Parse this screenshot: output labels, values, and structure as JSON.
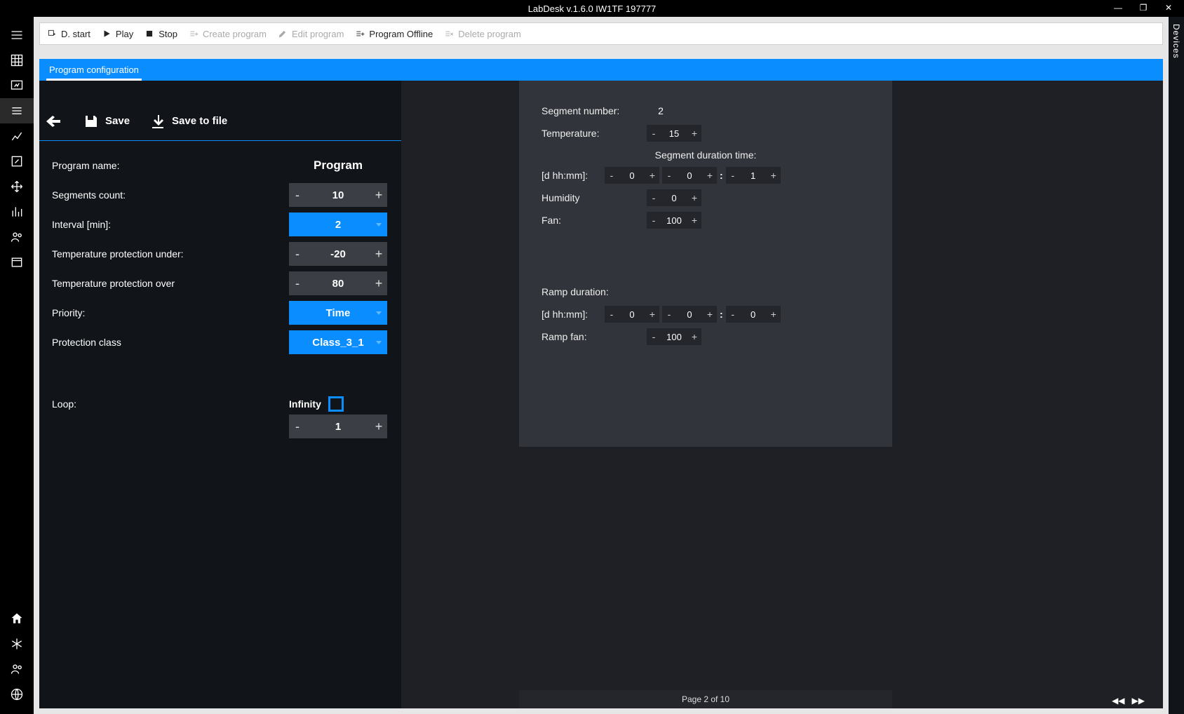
{
  "title": "LabDesk v.1.6.0 IW1TF 197777",
  "window_controls": {
    "min": "—",
    "max": "❐",
    "close": "✕"
  },
  "left_rail": {
    "items": [
      {
        "name": "menu-icon"
      },
      {
        "name": "grid-icon"
      },
      {
        "name": "monitor-icon"
      },
      {
        "name": "lines-icon",
        "active": true
      },
      {
        "name": "chart-icon"
      },
      {
        "name": "edit-square-icon"
      },
      {
        "name": "move-icon"
      },
      {
        "name": "bars-icon"
      },
      {
        "name": "people-icon"
      },
      {
        "name": "window-icon"
      }
    ],
    "bottom_items": [
      {
        "name": "home-icon"
      },
      {
        "name": "snow-icon"
      },
      {
        "name": "users-icon"
      },
      {
        "name": "globe-icon"
      }
    ]
  },
  "toolbar": {
    "d_start": "D. start",
    "play": "Play",
    "stop": "Stop",
    "create": "Create program",
    "edit": "Edit program",
    "offline": "Program Offline",
    "delete": "Delete program"
  },
  "tab": {
    "label": "Program configuration"
  },
  "actions": {
    "back": "",
    "save": "Save",
    "save_file": "Save to file"
  },
  "form": {
    "program_name_label": "Program name:",
    "program_name_value": "Program",
    "segments_count_label": "Segments count:",
    "segments_count_value": "10",
    "interval_label": "Interval [min]:",
    "interval_value": "2",
    "temp_under_label": "Temperature protection under:",
    "temp_under_value": "-20",
    "temp_over_label": "Temperature protection over",
    "temp_over_value": "80",
    "priority_label": "Priority:",
    "priority_value": "Time",
    "protection_class_label": "Protection class",
    "protection_class_value": "Class_3_1",
    "loop_label": "Loop:",
    "infinity_label": "Infinity",
    "loop_value": "1",
    "minus": "-",
    "plus": "+"
  },
  "segment": {
    "number_label": "Segment number:",
    "number_value": "2",
    "temperature_label": "Temperature:",
    "temperature_value": "15",
    "duration_title": "Segment duration time:",
    "dhhmm_label": "[d hh:mm]:",
    "dur_d": "0",
    "dur_h": "0",
    "dur_m": "1",
    "humidity_label": "Humidity",
    "humidity_value": "0",
    "fan_label": "Fan:",
    "fan_value": "100",
    "ramp_title": "Ramp duration:",
    "ramp_d": "0",
    "ramp_h": "0",
    "ramp_m": "0",
    "ramp_fan_label": "Ramp fan:",
    "ramp_fan_value": "100"
  },
  "pager": {
    "text": "Page 2 of 10",
    "prev": "◀◀",
    "next": "▶▶"
  },
  "right_rail": {
    "label": "Devices"
  }
}
